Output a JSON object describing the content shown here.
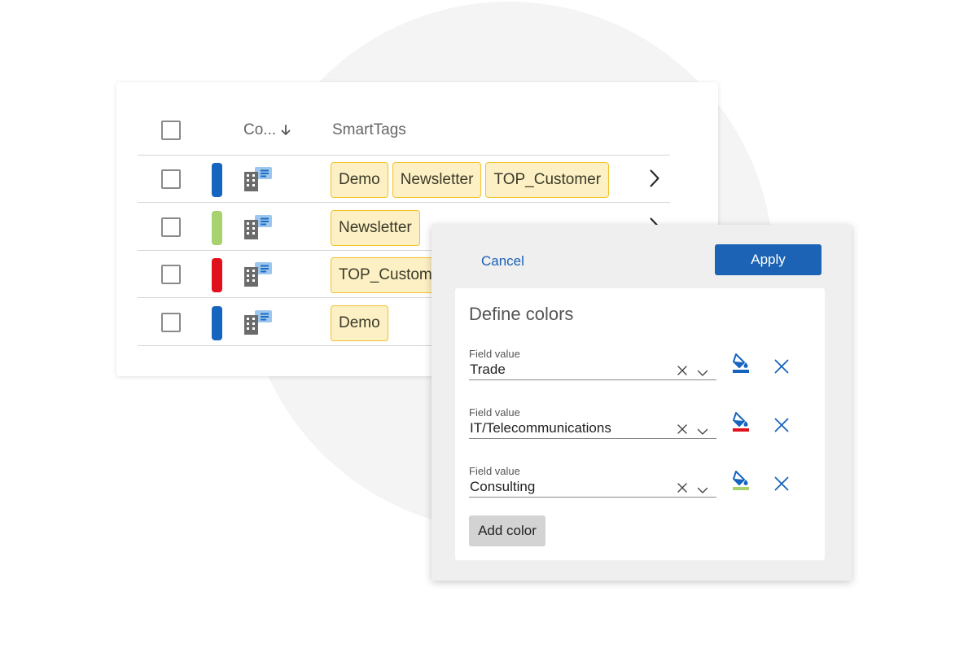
{
  "table": {
    "header": {
      "company_col": "Co...",
      "smarttags_col": "SmartTags"
    },
    "rows": [
      {
        "color": "#1565c0",
        "tags": [
          "Demo",
          "Newsletter",
          "TOP_Customer"
        ]
      },
      {
        "color": "#a8d26d",
        "tags": [
          "Newsletter"
        ]
      },
      {
        "color": "#e0101d",
        "tags": [
          "TOP_Custom"
        ]
      },
      {
        "color": "#1565c0",
        "tags": [
          "Demo"
        ]
      }
    ]
  },
  "dialog": {
    "cancel_label": "Cancel",
    "apply_label": "Apply",
    "title": "Define colors",
    "fields": [
      {
        "label": "Field value",
        "value": "Trade",
        "color": "#1565c0"
      },
      {
        "label": "Field value",
        "value": "IT/Telecommunications",
        "color": "#e0101d"
      },
      {
        "label": "Field value",
        "value": "Consulting",
        "color": "#a8d26d"
      }
    ],
    "add_color_label": "Add color"
  },
  "icons": {
    "header_checkbox": "checkbox-icon",
    "sort": "arrow-down-icon",
    "company": "company-building-icon",
    "row_open": "chevron-right-icon",
    "clear": "clear-x-icon",
    "dropdown": "chevron-down-icon",
    "paint": "paint-bucket-icon",
    "remove": "close-icon"
  },
  "colors": {
    "accent": "#1c63b5",
    "tag_bg": "#fdf0c4",
    "tag_border": "#f0c229"
  }
}
